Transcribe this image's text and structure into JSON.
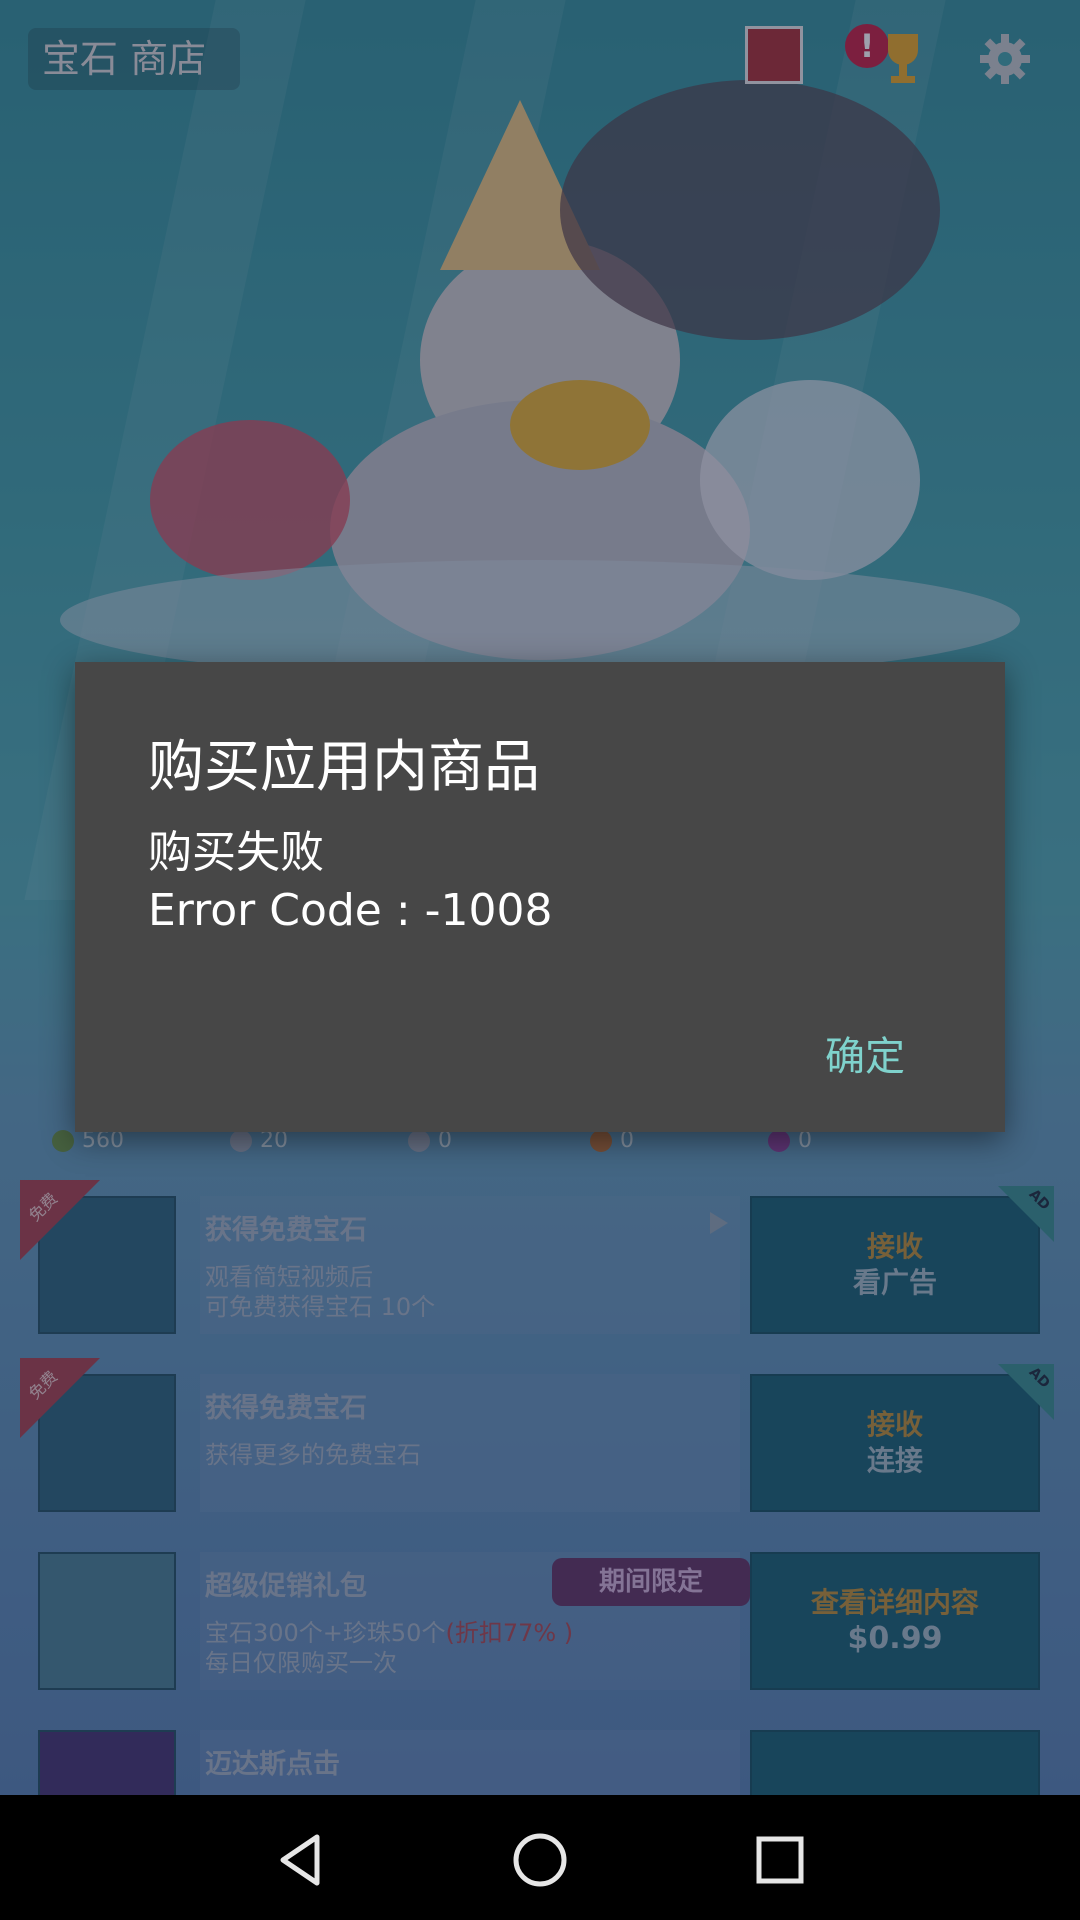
{
  "header": {
    "title": "宝石 商店",
    "icons": [
      "album-icon",
      "alert-icon",
      "trophy-icon",
      "gear-icon"
    ]
  },
  "stats": {
    "hearts": "560",
    "shells": "20",
    "fish": "0",
    "orange": "0",
    "purple": "0"
  },
  "shop": {
    "items": [
      {
        "ribbon": "免费",
        "name": "获得免费宝石",
        "desc": "观看简短视频后\n可免费获得宝石 10个",
        "action_line1": "接收",
        "action_line2": "看广告",
        "ad": "AD"
      },
      {
        "ribbon": "免费",
        "name": "获得免费宝石",
        "desc": "获得更多的免费宝石",
        "action_line1": "接收",
        "action_line2": "连接",
        "ad": "AD"
      },
      {
        "name": "超级促销礼包",
        "limited": "期间限定",
        "desc_prefix": "宝石300个+珍珠50个",
        "desc_strong": "(折扣77% )",
        "desc_suffix": "每日仅限购买一次",
        "action_line1": "查看详细内容",
        "action_line2": "$0.99"
      },
      {
        "name": "迈达斯点击"
      }
    ]
  },
  "dialog": {
    "title": "购买应用内商品",
    "message_line1": "购买失败",
    "message_line2": "Error Code : -1008",
    "ok_label": "确定"
  },
  "navbar": {
    "icons": [
      "back-icon",
      "home-icon",
      "recents-icon"
    ]
  }
}
